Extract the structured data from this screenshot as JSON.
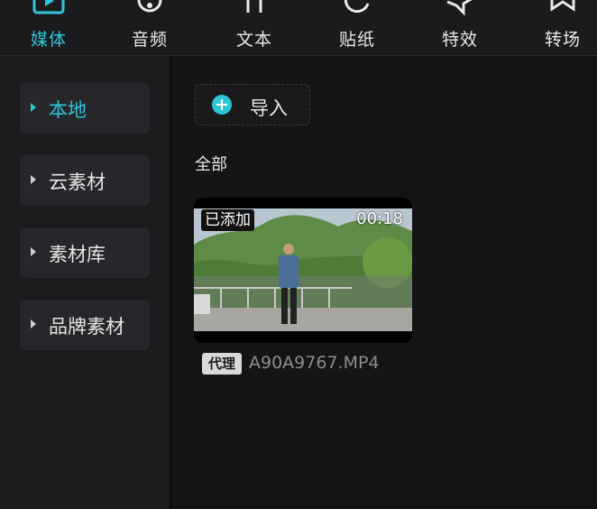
{
  "toolbar": {
    "tabs": [
      {
        "label": "媒体",
        "icon": "media-icon",
        "active": true
      },
      {
        "label": "音频",
        "icon": "audio-icon",
        "active": false
      },
      {
        "label": "文本",
        "icon": "text-icon",
        "active": false
      },
      {
        "label": "贴纸",
        "icon": "sticker-icon",
        "active": false
      },
      {
        "label": "特效",
        "icon": "effects-icon",
        "active": false
      },
      {
        "label": "转场",
        "icon": "transition-icon",
        "active": false
      }
    ]
  },
  "sidebar": {
    "items": [
      {
        "label": "本地",
        "active": true
      },
      {
        "label": "云素材",
        "active": false
      },
      {
        "label": "素材库",
        "active": false
      },
      {
        "label": "品牌素材",
        "active": false
      }
    ]
  },
  "main": {
    "import_label": "导入",
    "section_title": "全部",
    "media": {
      "added_badge": "已添加",
      "duration": "00:18",
      "proxy_badge": "代理",
      "filename": "A90A9767.MP4"
    }
  },
  "colors": {
    "accent": "#2ec5d6",
    "background": "#141416",
    "panel": "#1c1c1f",
    "item": "#27272b"
  }
}
